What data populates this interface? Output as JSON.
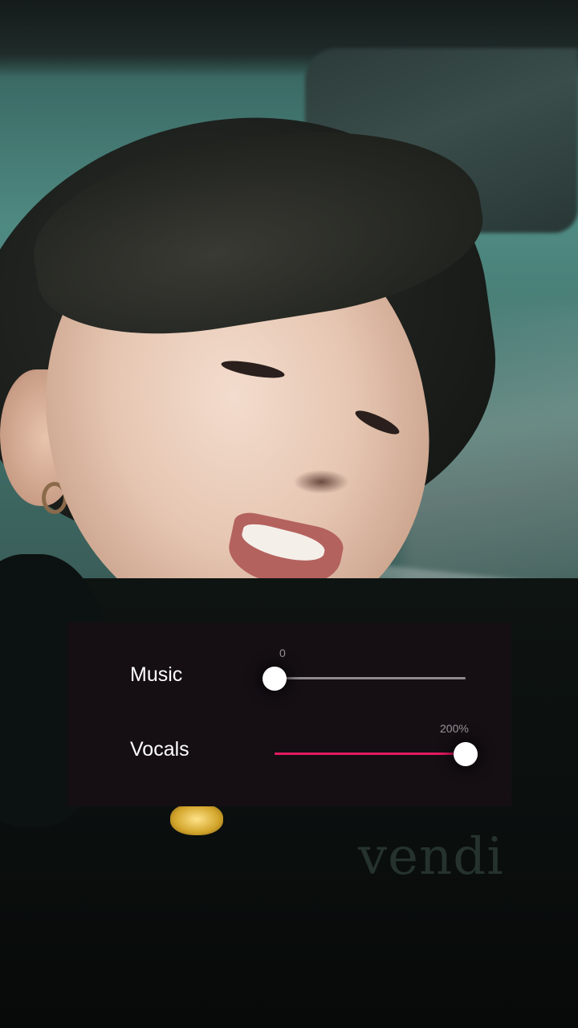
{
  "background": {
    "watermark_text": "vendi"
  },
  "mixer": {
    "panel_color": "#150f14",
    "accent_color": "#e5195f",
    "music": {
      "label": "Music",
      "value_text": "0",
      "level": 0.0
    },
    "vocals": {
      "label": "Vocals",
      "value_text": "200%",
      "level": 1.0
    }
  }
}
